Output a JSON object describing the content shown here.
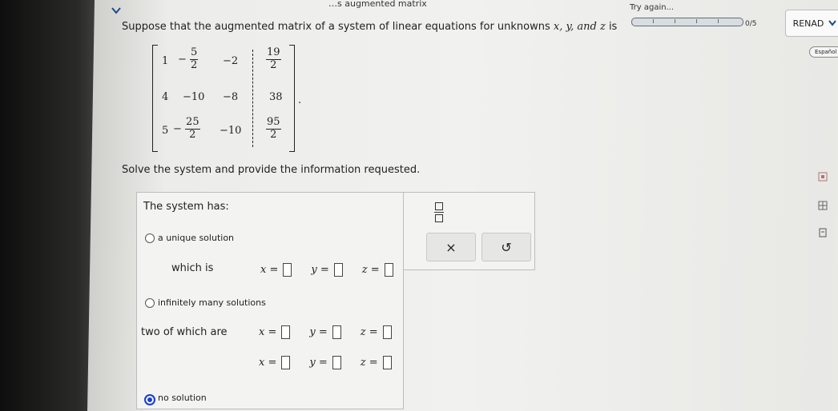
{
  "header": {
    "title": "…s augmented matrix",
    "try_again": "Try again...",
    "score": "0/5",
    "user": "RENAD",
    "espanol": "Español"
  },
  "question": {
    "prompt_prefix": "Suppose that the augmented matrix of a system of linear equations for unknowns ",
    "unknowns": "x, y, and z",
    "prompt_suffix": " is",
    "matrix": {
      "r1": {
        "a": "1",
        "b_sign": "−",
        "b_num": "5",
        "b_den": "2",
        "c": "−2",
        "d_num": "19",
        "d_den": "2"
      },
      "r2": {
        "a": "4",
        "b": "−10",
        "c": "−8",
        "d": "38"
      },
      "r3": {
        "a": "5",
        "b_sign": "−",
        "b_num": "25",
        "b_den": "2",
        "c": "−10",
        "d_num": "95",
        "d_den": "2"
      },
      "period": "."
    },
    "solve_text": "Solve the system and provide the information requested."
  },
  "answer": {
    "heading": "The system has:",
    "opt_unique": "a unique solution",
    "which_is": "which is",
    "opt_infinite": "infinitely many solutions",
    "two_of_which": "two of which are",
    "opt_none": "no solution",
    "x": "x =",
    "y": "y =",
    "z": "z =",
    "selected": "no solution"
  },
  "tools": {
    "clear": "×",
    "undo": "↺"
  },
  "colors": {
    "radio_selected": "#1a3fd1"
  }
}
